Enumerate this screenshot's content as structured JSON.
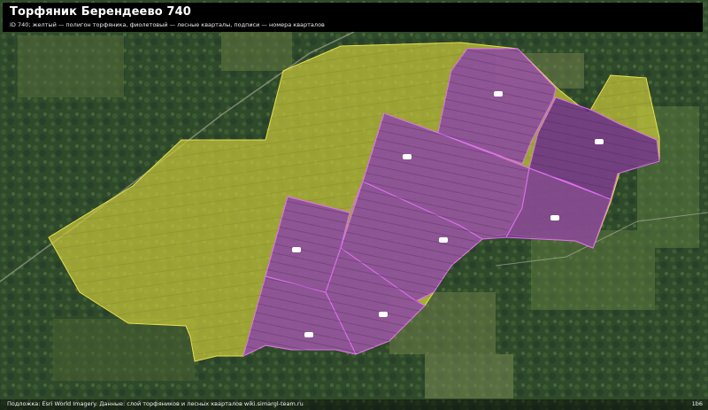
{
  "header": {
    "title": "Торфяник Берендеево 740",
    "subtitle": "ID 740; желтый — полигон торфяника, фиолетовый — лесные кварталы, подписи — номера кварталов"
  },
  "footer": {
    "attribution": "Подложка: Esri World Imagery. Данные: слой торфяников и лесных кварталов wiki.simargl-team.ru",
    "corner_number": "1b6"
  },
  "colors": {
    "peat_fill": "#c8c83a",
    "peat_outline": "#e8e050",
    "quarter_fill": "#8a3fb0",
    "quarter_outline": "#e070f0",
    "title_bar": "#000000"
  },
  "map_layers": [
    "satellite-imagery",
    "peat-polygon",
    "forest-quarters"
  ]
}
